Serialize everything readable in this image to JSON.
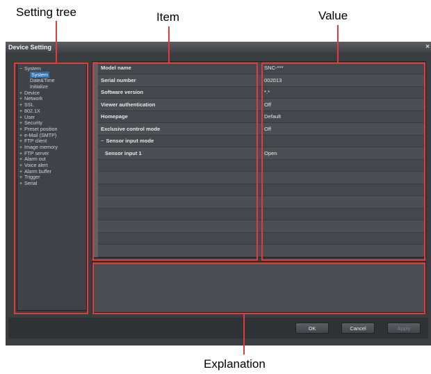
{
  "callouts": {
    "setting_tree": "Setting tree",
    "item": "Item",
    "value": "Value",
    "explanation": "Explanation"
  },
  "window": {
    "title": "Device Setting",
    "close": "×"
  },
  "tree": [
    {
      "label": "System",
      "expander": "−",
      "level": 0,
      "selected": false
    },
    {
      "label": "System",
      "expander": "",
      "level": 1,
      "selected": true
    },
    {
      "label": "Date&Time",
      "expander": "",
      "level": 1,
      "selected": false
    },
    {
      "label": "Initialize",
      "expander": "",
      "level": 1,
      "selected": false
    },
    {
      "label": "Device",
      "expander": "+",
      "level": 0,
      "selected": false
    },
    {
      "label": "Network",
      "expander": "+",
      "level": 0,
      "selected": false
    },
    {
      "label": "SSL",
      "expander": "+",
      "level": 0,
      "selected": false
    },
    {
      "label": "802.1X",
      "expander": "+",
      "level": 0,
      "selected": false
    },
    {
      "label": "User",
      "expander": "+",
      "level": 0,
      "selected": false
    },
    {
      "label": "Security",
      "expander": "+",
      "level": 0,
      "selected": false
    },
    {
      "label": "Preset position",
      "expander": "+",
      "level": 0,
      "selected": false
    },
    {
      "label": "e-Mail (SMTP)",
      "expander": "+",
      "level": 0,
      "selected": false
    },
    {
      "label": "FTP client",
      "expander": "+",
      "level": 0,
      "selected": false
    },
    {
      "label": "Image memory",
      "expander": "+",
      "level": 0,
      "selected": false
    },
    {
      "label": "FTP server",
      "expander": "+",
      "level": 0,
      "selected": false
    },
    {
      "label": "Alarm out",
      "expander": "+",
      "level": 0,
      "selected": false
    },
    {
      "label": "Voice alert",
      "expander": "+",
      "level": 0,
      "selected": false
    },
    {
      "label": "Alarm buffer",
      "expander": "+",
      "level": 0,
      "selected": false
    },
    {
      "label": "Trigger",
      "expander": "+",
      "level": 0,
      "selected": false
    },
    {
      "label": "Serial",
      "expander": "+",
      "level": 0,
      "selected": false
    }
  ],
  "rows": [
    {
      "item": "Model name",
      "value": "SNC-***",
      "expander": "",
      "sub": false
    },
    {
      "item": "Serial number",
      "value": "002013",
      "expander": "",
      "sub": false
    },
    {
      "item": "Software version",
      "value": "*.*",
      "expander": "",
      "sub": false
    },
    {
      "item": "Viewer authentication",
      "value": "Off",
      "expander": "",
      "sub": false
    },
    {
      "item": "Homepage",
      "value": "Default",
      "expander": "",
      "sub": false
    },
    {
      "item": "Exclusive control mode",
      "value": "Off",
      "expander": "",
      "sub": false
    },
    {
      "item": "Sensor input mode",
      "value": "",
      "expander": "−",
      "sub": false
    },
    {
      "item": "Sensor input 1",
      "value": "Open",
      "expander": "",
      "sub": true
    }
  ],
  "explanation_text": "",
  "buttons": {
    "ok": "OK",
    "cancel": "Cancel",
    "apply": "Apply"
  },
  "colors": {
    "annotation_red": "#e23b3b",
    "selection_blue": "#2b6fb6"
  }
}
